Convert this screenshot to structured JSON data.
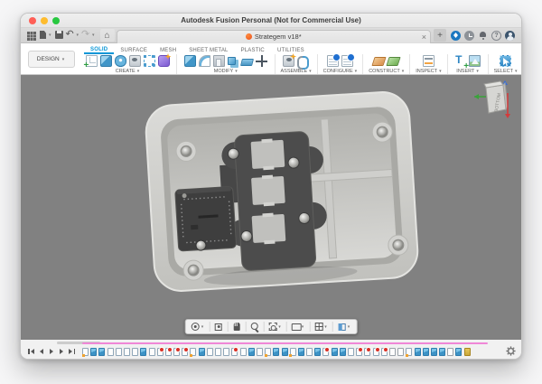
{
  "window": {
    "title": "Autodesk Fusion Personal (Not for Commercial Use)"
  },
  "titlebar": {
    "traffic_lights": [
      "close",
      "minimize",
      "zoom"
    ]
  },
  "appbar": {
    "quick_icons": [
      {
        "name": "app-launcher",
        "caret": false
      },
      {
        "name": "file-new",
        "caret": true
      },
      {
        "name": "save",
        "caret": false
      },
      {
        "name": "undo",
        "caret": true
      },
      {
        "name": "redo",
        "caret": true
      }
    ],
    "doc_tab": {
      "title": "Strategem v18*",
      "close": "×"
    },
    "new_tab": "+",
    "right_icons": [
      {
        "name": "extensions"
      },
      {
        "name": "job-status"
      },
      {
        "name": "notifications"
      },
      {
        "name": "help"
      },
      {
        "name": "profile"
      }
    ]
  },
  "ribbon": {
    "design_button": {
      "label": "DESIGN",
      "caret": "▾"
    },
    "caret_char": "▾",
    "tabs": [
      {
        "label": "SOLID",
        "active": true
      },
      {
        "label": "SURFACE",
        "active": false
      },
      {
        "label": "MESH",
        "active": false
      },
      {
        "label": "SHEET METAL",
        "active": false
      },
      {
        "label": "PLASTIC",
        "active": false
      },
      {
        "label": "UTILITIES",
        "active": false
      }
    ],
    "groups": [
      {
        "label": "CREATE",
        "items": [
          {
            "name": "create-sketch",
            "style": "sketch"
          },
          {
            "name": "extrude",
            "style": "cube"
          },
          {
            "name": "revolve",
            "style": "revolve"
          },
          {
            "name": "hole",
            "style": "hole"
          },
          {
            "name": "rectangular-pattern",
            "style": "pattern"
          },
          {
            "name": "create-form",
            "style": "form star"
          }
        ]
      },
      {
        "label": "MODIFY",
        "items": [
          {
            "name": "press-pull",
            "style": "cube"
          },
          {
            "name": "fillet",
            "style": "fillet"
          },
          {
            "name": "shell",
            "style": "shell"
          },
          {
            "name": "combine",
            "style": "combine"
          },
          {
            "name": "offset-face",
            "style": "offset"
          },
          {
            "name": "move-copy",
            "style": "move"
          }
        ]
      },
      {
        "label": "ASSEMBLE",
        "items": [
          {
            "name": "new-component",
            "style": "hole star"
          },
          {
            "name": "joint",
            "style": "joint"
          }
        ]
      },
      {
        "label": "CONFIGURE",
        "items": [
          {
            "name": "configuration-table",
            "style": "config"
          },
          {
            "name": "insert-configuration",
            "style": "config"
          }
        ]
      },
      {
        "label": "CONSTRUCT",
        "items": [
          {
            "name": "construction-plane",
            "style": "plane-o"
          },
          {
            "name": "offset-plane",
            "style": "plane-g"
          }
        ]
      },
      {
        "label": "INSPECT",
        "items": [
          {
            "name": "measure",
            "style": "measure"
          }
        ]
      },
      {
        "label": "INSERT",
        "items": [
          {
            "name": "insert-derive",
            "style": "insert-t"
          },
          {
            "name": "canvas",
            "style": "canvas"
          }
        ]
      },
      {
        "label": "SELECT",
        "items": [
          {
            "name": "select-tool",
            "style": "select"
          }
        ]
      }
    ]
  },
  "viewport": {
    "viewcube": {
      "face_label": "BOTTOM"
    },
    "navbar": [
      {
        "name": "orbit",
        "caret": true
      },
      {
        "name": "look-at",
        "caret": false
      },
      {
        "name": "pan",
        "caret": false
      },
      {
        "name": "zoom",
        "caret": false
      },
      {
        "name": "fit",
        "caret": true
      },
      {
        "name": "display-settings",
        "caret": true
      },
      {
        "name": "grid-snaps",
        "caret": true
      },
      {
        "name": "viewports",
        "caret": true
      }
    ]
  },
  "timeline": {
    "playback": [
      "skip-start",
      "step-back",
      "play",
      "step-forward",
      "skip-end"
    ],
    "features": [
      "sketch",
      "solid",
      "solid",
      "page",
      "page",
      "page",
      "page",
      "solid",
      "page",
      "dot",
      "dot",
      "dot",
      "dot",
      "sketch",
      "solid",
      "page",
      "page",
      "page",
      "dot",
      "page",
      "solid",
      "page",
      "sketch",
      "solid",
      "solid",
      "sketch",
      "solid",
      "page",
      "solid",
      "dot",
      "solid",
      "solid",
      "page",
      "dot",
      "dot",
      "dot",
      "dot",
      "outline",
      "outline",
      "sketch",
      "solid",
      "solid",
      "solid",
      "solid",
      "outline",
      "solid",
      "gold"
    ],
    "marker_color": "#ef87d7"
  },
  "colors": {
    "accent_blue": "#0696d7",
    "viewport_bg": "#818181",
    "traffic_red": "#ff5f57",
    "traffic_yellow": "#febc2e",
    "traffic_green": "#28c840"
  }
}
